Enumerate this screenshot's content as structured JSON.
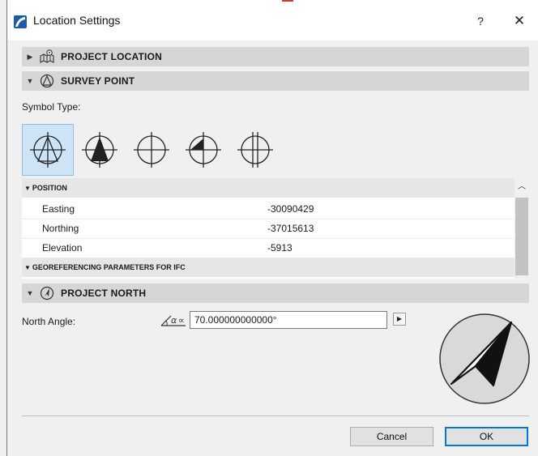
{
  "window": {
    "title": "Location Settings",
    "help_label": "?",
    "close_label": "✕"
  },
  "sections": {
    "project_location": "PROJECT LOCATION",
    "survey_point": "SURVEY POINT",
    "project_north": "PROJECT NORTH"
  },
  "survey_point": {
    "symbol_type_label": "Symbol Type:",
    "selected_symbol_index": 0
  },
  "position_table": {
    "group_position": "POSITION",
    "group_georef": "GEOREFERENCING PARAMETERS FOR IFC",
    "rows": [
      {
        "key": "Easting",
        "value": "-30090429"
      },
      {
        "key": "Northing",
        "value": "-37015613"
      },
      {
        "key": "Elevation",
        "value": "-5913"
      }
    ]
  },
  "project_north": {
    "label": "North Angle:",
    "angle_value": "70.000000000000°",
    "angle_icon_text": "∝"
  },
  "footer": {
    "cancel_label": "Cancel",
    "ok_label": "OK"
  },
  "colors": {
    "accent": "#0078d7",
    "selection": "#cde4f7",
    "section_bar": "#d6d6d6"
  }
}
